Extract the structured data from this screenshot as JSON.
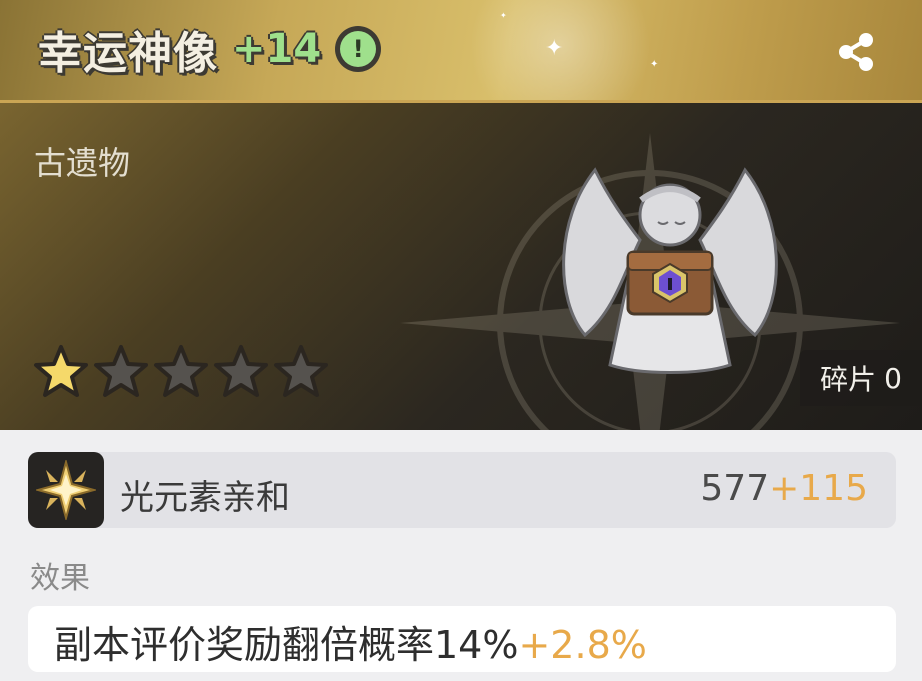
{
  "item": {
    "name": "幸运神像",
    "level": "+14",
    "info_symbol": "!",
    "category": "古遗物",
    "rating": 1,
    "max_rating": 5,
    "fragments_label": "碎片",
    "fragments_count": "0"
  },
  "stat": {
    "icon": "light-element-star-icon",
    "name": "光元素亲和",
    "base": "577",
    "bonus": "+115"
  },
  "effect": {
    "label": "效果",
    "description": "副本评价奖励翻倍概率14%",
    "bonus": "+2.8%"
  },
  "colors": {
    "bonus": "#e8a94a",
    "level": "#9fe08c",
    "header_gold": "#c6a857",
    "star_active": "#f5d96a"
  }
}
